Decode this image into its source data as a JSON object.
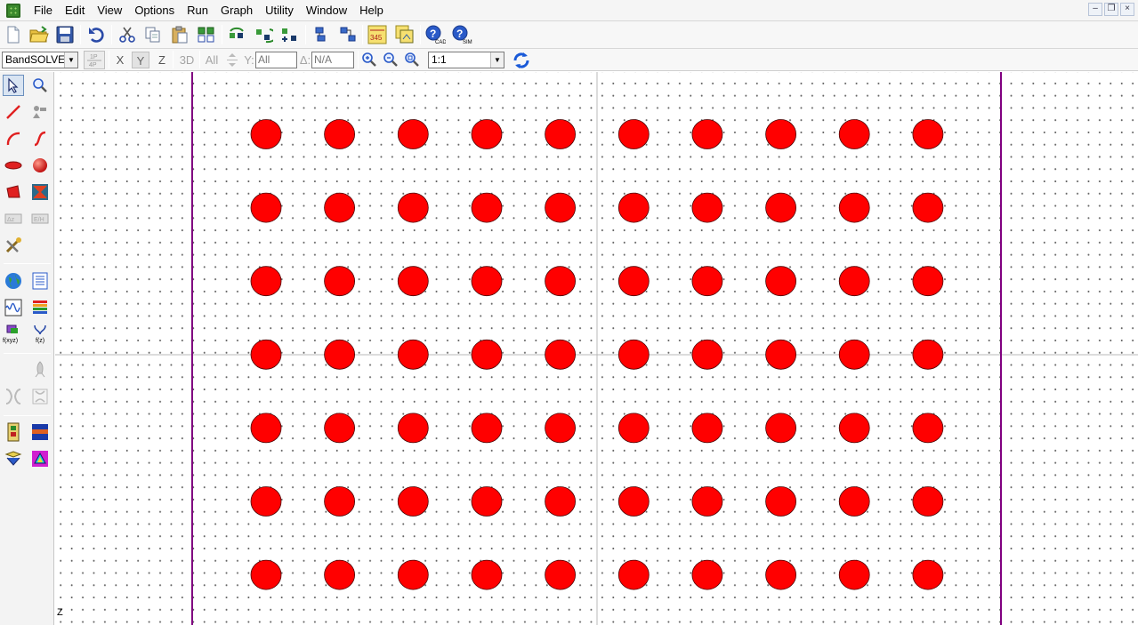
{
  "menu": {
    "items": [
      "File",
      "Edit",
      "View",
      "Options",
      "Run",
      "Graph",
      "Utility",
      "Window",
      "Help"
    ]
  },
  "toolbar2": {
    "simulator_select": "BandSOLVE",
    "axis_x": "X",
    "axis_y": "Y",
    "axis_z": "Z",
    "view_3d": "3D",
    "all_label": "All",
    "coord_label": "Y:",
    "coord_value": "All",
    "delta_label": "Δ:",
    "delta_value": "N/A",
    "zoom_select": "1:1"
  },
  "canvas": {
    "axis_label": "Z",
    "lattice": {
      "rows": 7,
      "columns": 10,
      "fill_color": "#ff0000"
    },
    "boundary_color": "#800080"
  }
}
